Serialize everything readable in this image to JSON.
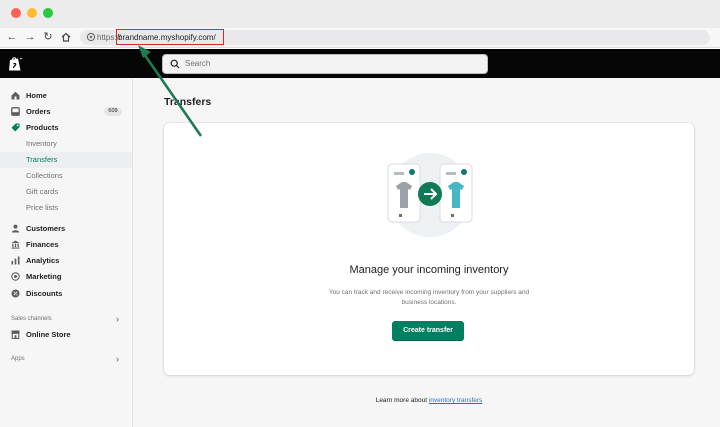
{
  "browser": {
    "url_scheme": "https://",
    "url_domain": "brandname.myshopify.com/",
    "nav_icons": [
      "back-icon",
      "forward-icon",
      "reload-icon",
      "home-icon"
    ],
    "annotation_color": "#d9262b",
    "arrow_color": "#1f7a52"
  },
  "topbar": {
    "search_placeholder": "Search"
  },
  "sidebar": {
    "items": [
      {
        "label": "Home",
        "icon": "home-icon"
      },
      {
        "label": "Orders",
        "icon": "orders-icon",
        "badge": "609"
      },
      {
        "label": "Products",
        "icon": "tag-icon"
      },
      {
        "label": "Inventory"
      },
      {
        "label": "Transfers"
      },
      {
        "label": "Collections"
      },
      {
        "label": "Gift cards"
      },
      {
        "label": "Price lists"
      },
      {
        "label": "Customers",
        "icon": "person-icon"
      },
      {
        "label": "Finances",
        "icon": "bank-icon"
      },
      {
        "label": "Analytics",
        "icon": "bar-chart-icon"
      },
      {
        "label": "Marketing",
        "icon": "target-icon"
      },
      {
        "label": "Discounts",
        "icon": "discount-icon"
      }
    ],
    "sales_channels_label": "Sales channels",
    "online_store_label": "Online Store",
    "apps_label": "Apps"
  },
  "main": {
    "title": "Transfers",
    "empty_state": {
      "heading": "Manage your incoming inventory",
      "description": "You can track and receive incoming inventory from your suppliers and business locations.",
      "button_label": "Create transfer"
    },
    "footer_prefix": "Learn more about",
    "footer_link": "inventory transfers"
  },
  "colors": {
    "accent": "#008060",
    "topbar": "#060606",
    "link": "#2c6ecb"
  }
}
